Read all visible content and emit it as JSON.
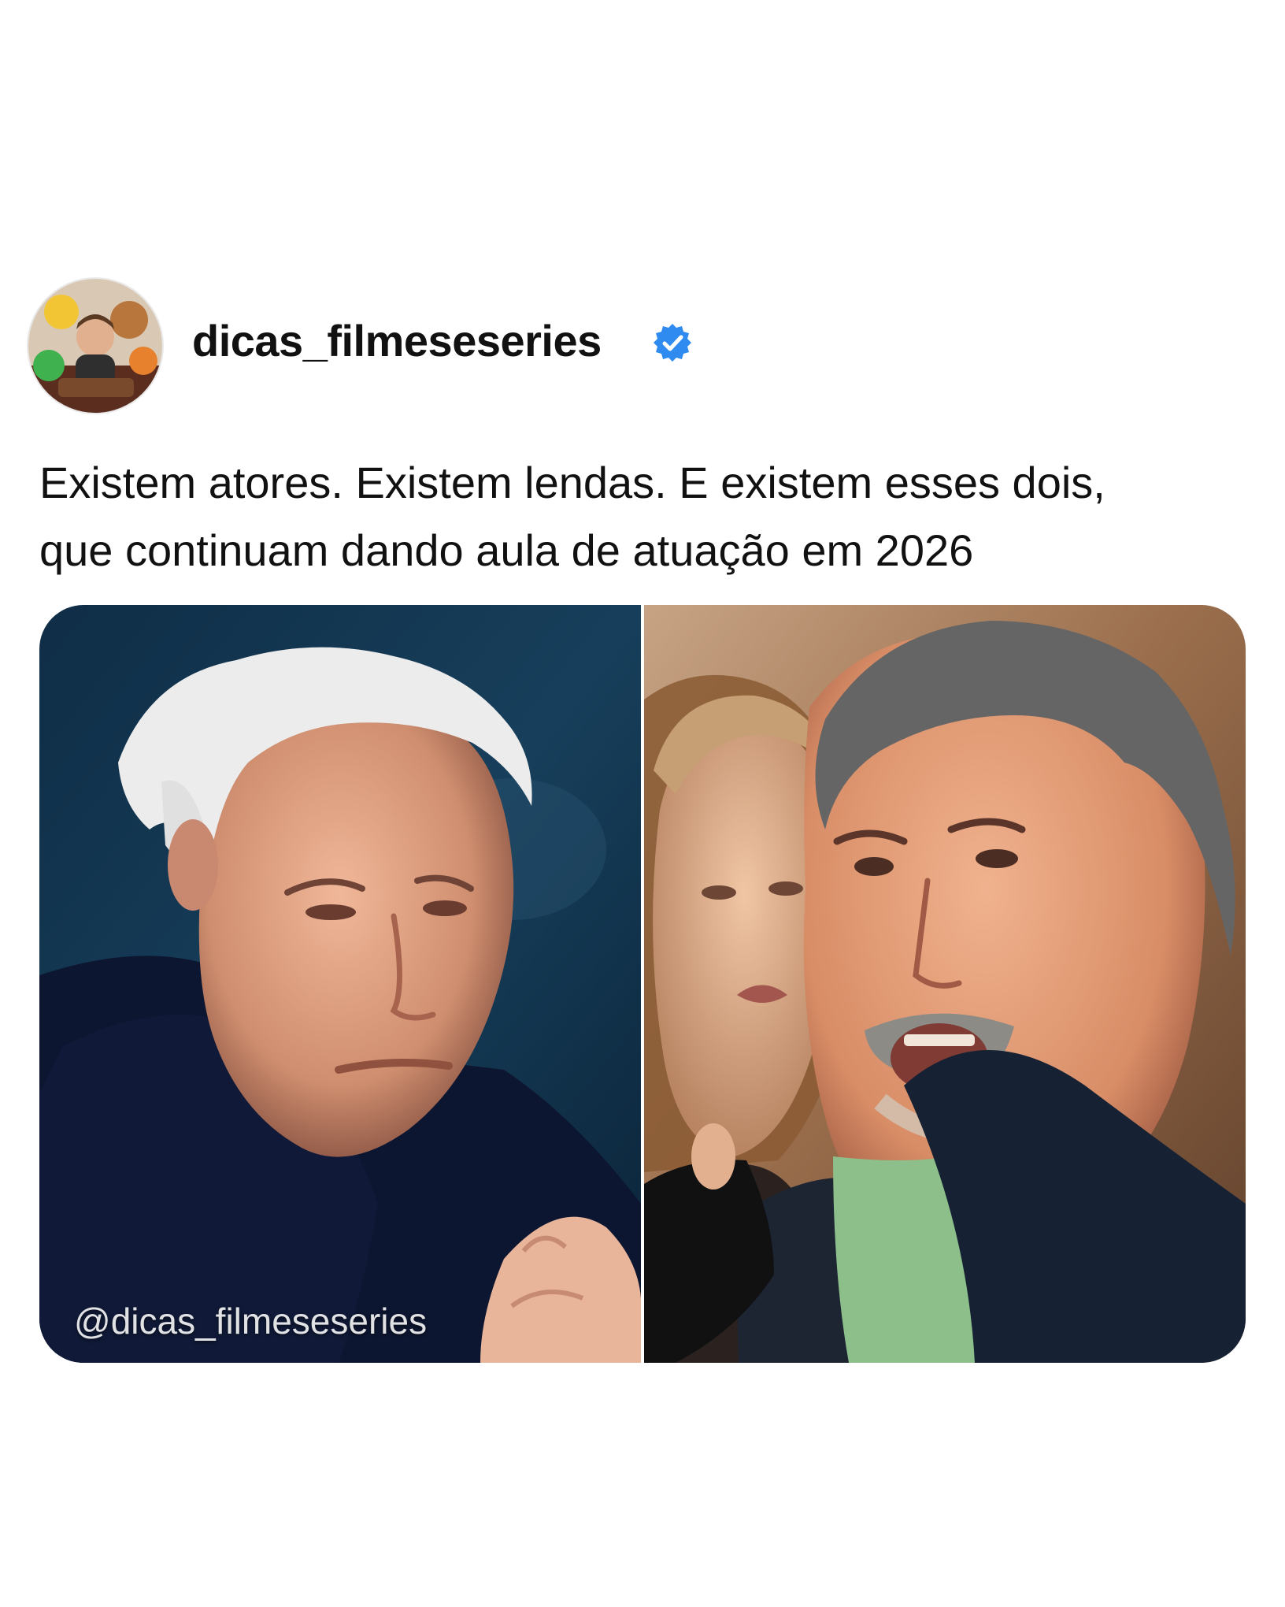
{
  "post": {
    "username": "dicas_filmeseseries",
    "verified": true,
    "text_lines": [
      "Existem atores. Existem lendas. E existem esses dois,",
      "que continuam dando aula de atuação em 2026"
    ]
  },
  "media": {
    "watermark": "@dicas_filmeseseries"
  },
  "icons": {
    "verified_badge": "verified-check-icon"
  },
  "colors": {
    "background": "#ffffff",
    "text": "#111111",
    "verified_blue": "#2f8bf0"
  }
}
